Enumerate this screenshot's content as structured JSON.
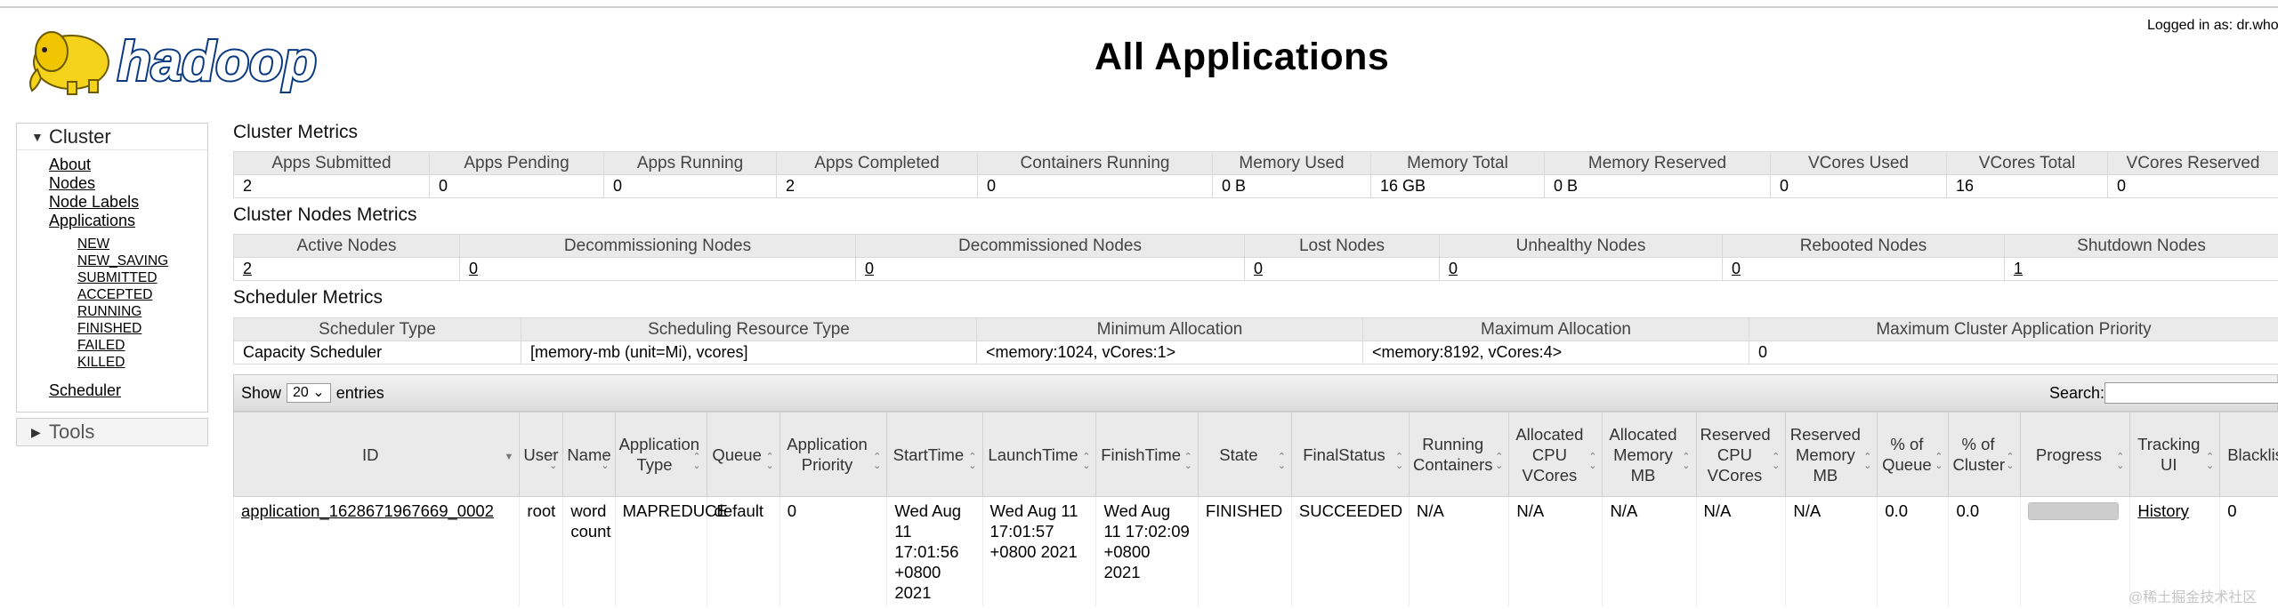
{
  "logo_text": "hadoop",
  "page_title": "All Applications",
  "logged_in": "Logged in as: dr.who",
  "sidebar": {
    "cluster_title": "Cluster",
    "cluster_links": [
      "About",
      "Nodes",
      "Node Labels",
      "Applications"
    ],
    "app_states": [
      "NEW",
      "NEW_SAVING",
      "SUBMITTED",
      "ACCEPTED",
      "RUNNING",
      "FINISHED",
      "FAILED",
      "KILLED"
    ],
    "scheduler_link": "Scheduler",
    "tools_title": "Tools"
  },
  "cluster_metrics": {
    "title": "Cluster Metrics",
    "headers": [
      "Apps Submitted",
      "Apps Pending",
      "Apps Running",
      "Apps Completed",
      "Containers Running",
      "Memory Used",
      "Memory Total",
      "Memory Reserved",
      "VCores Used",
      "VCores Total",
      "VCores Reserved"
    ],
    "values": [
      "2",
      "0",
      "0",
      "2",
      "0",
      "0 B",
      "16 GB",
      "0 B",
      "0",
      "16",
      "0"
    ]
  },
  "nodes_metrics": {
    "title": "Cluster Nodes Metrics",
    "headers": [
      "Active Nodes",
      "Decommissioning Nodes",
      "Decommissioned Nodes",
      "Lost Nodes",
      "Unhealthy Nodes",
      "Rebooted Nodes",
      "Shutdown Nodes"
    ],
    "values": [
      "2",
      "0",
      "0",
      "0",
      "0",
      "0",
      "1"
    ]
  },
  "scheduler_metrics": {
    "title": "Scheduler Metrics",
    "headers": [
      "Scheduler Type",
      "Scheduling Resource Type",
      "Minimum Allocation",
      "Maximum Allocation",
      "Maximum Cluster Application Priority"
    ],
    "values": [
      "Capacity Scheduler",
      "[memory-mb (unit=Mi), vcores]",
      "<memory:1024, vCores:1>",
      "<memory:8192, vCores:4>",
      "0"
    ]
  },
  "apps_table": {
    "show_label": "Show",
    "page_size": "20",
    "entries_label": "entries",
    "search_label": "Search:",
    "search_value": "",
    "columns": [
      "ID",
      "User",
      "Name",
      "Application Type",
      "Queue",
      "Application Priority",
      "StartTime",
      "LaunchTime",
      "FinishTime",
      "State",
      "FinalStatus",
      "Running Containers",
      "Allocated CPU VCores",
      "Allocated Memory MB",
      "Reserved CPU VCores",
      "Reserved Memory MB",
      "% of Queue",
      "% of Cluster",
      "Progress",
      "Tracking UI",
      "Blacklisted Nodes"
    ],
    "rows": [
      {
        "id": "application_1628671967669_0002",
        "user": "root",
        "name": "word count",
        "type": "MAPREDUCE",
        "queue": "default",
        "priority": "0",
        "start": "Wed Aug 11 17:01:56 +0800 2021",
        "launch": "Wed Aug 11 17:01:57 +0800 2021",
        "finish": "Wed Aug 11 17:02:09 +0800 2021",
        "state": "FINISHED",
        "final_status": "SUCCEEDED",
        "running_containers": "N/A",
        "alloc_vcores": "N/A",
        "alloc_mem": "N/A",
        "res_vcores": "N/A",
        "res_mem": "N/A",
        "pct_queue": "0.0",
        "pct_cluster": "0.0",
        "progress": 1.0,
        "tracking": "History",
        "blacklisted": "0"
      }
    ]
  },
  "watermark": "@稀土掘金技术社区"
}
